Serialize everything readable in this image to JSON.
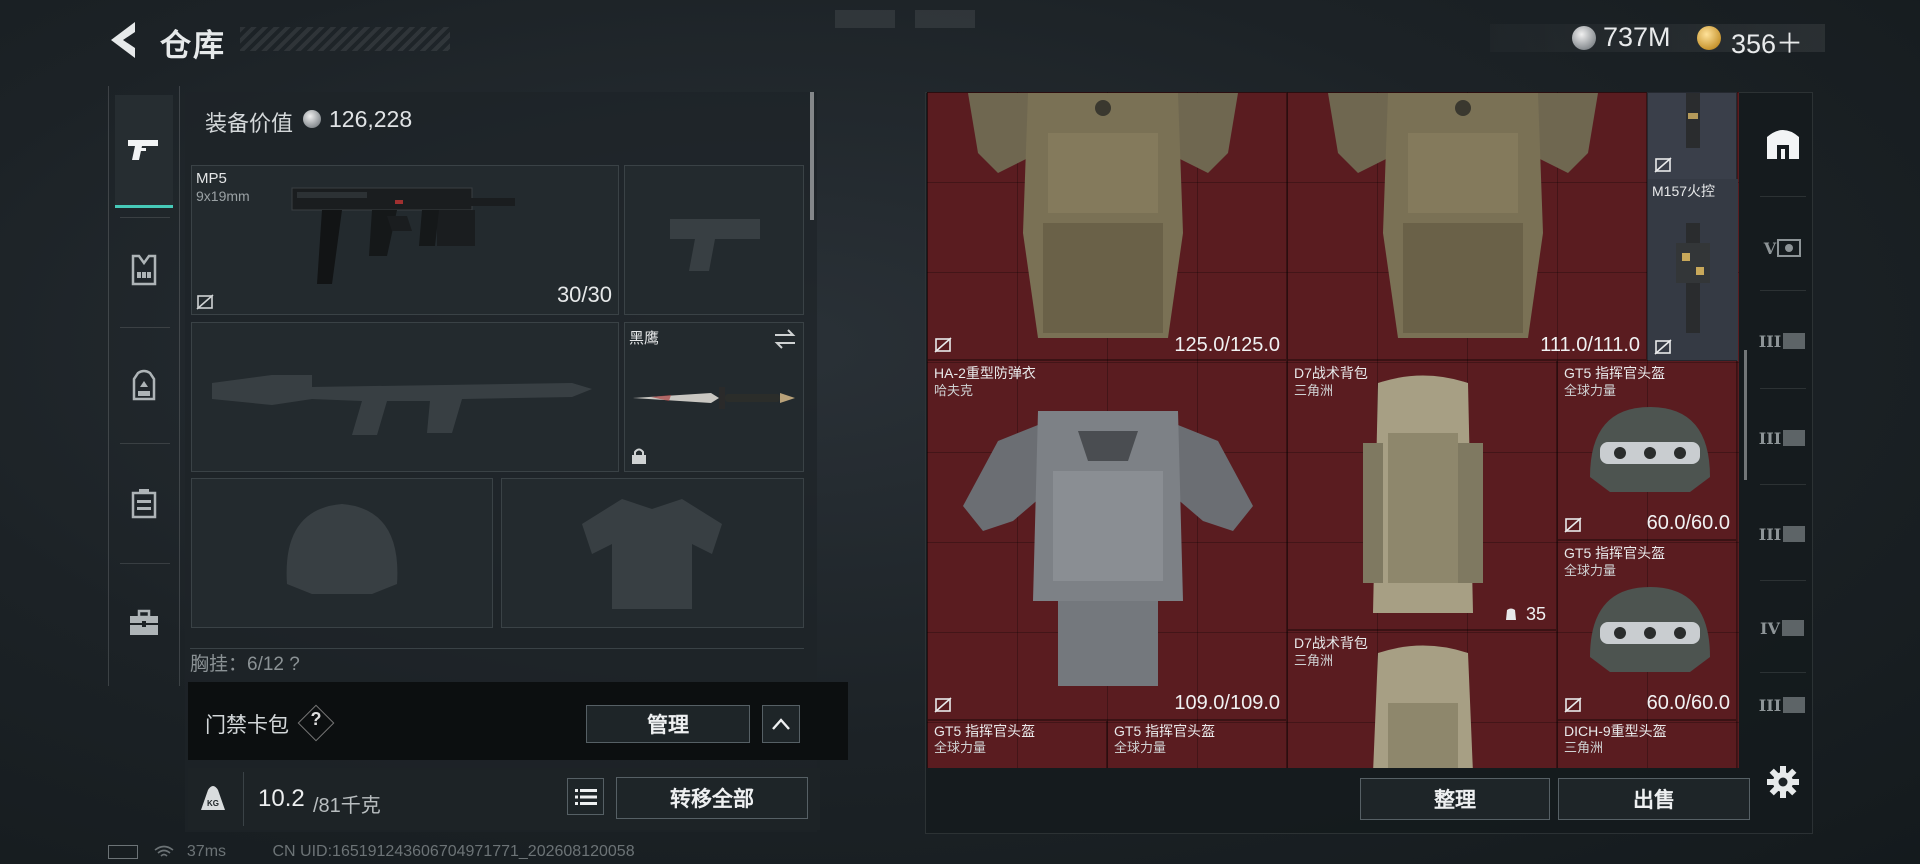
{
  "header": {
    "title": "仓库",
    "currencies": [
      {
        "name": "silver-coin",
        "amount": "737M"
      },
      {
        "name": "gold-coin",
        "amount": "356＋"
      }
    ]
  },
  "left_rail": {
    "items": [
      {
        "icon": "pistol-icon",
        "active": true
      },
      {
        "icon": "vest-icon",
        "active": false
      },
      {
        "icon": "backpack-icon",
        "active": false
      },
      {
        "icon": "container-icon",
        "active": false
      },
      {
        "icon": "case-icon",
        "active": false
      }
    ]
  },
  "loadout": {
    "value_label": "装备价值",
    "value": "126,228",
    "primary": {
      "name": "MP5",
      "caliber": "9x19mm",
      "ammo": "30/30"
    },
    "melee": {
      "name": "黑鹰"
    },
    "chest_row": "胸挂：6/12  ?",
    "card_pack_label": "门禁卡包",
    "card_help": "?",
    "manage_label": "管理",
    "weight_value": "10.2",
    "weight_max": "/81千克",
    "weight_icon_text": "KG",
    "transfer_all_label": "转移全部"
  },
  "stash": {
    "items": [
      {
        "name": "",
        "sub": "",
        "durability": "125.0/125.0",
        "kind": "vest-tan"
      },
      {
        "name": "",
        "sub": "",
        "durability": "111.0/111.0",
        "kind": "vest-tan"
      },
      {
        "name": "M157火控",
        "sub": "",
        "durability": "",
        "kind": "scope"
      },
      {
        "name": "HA-2重型防弹衣",
        "sub": "哈夫克",
        "durability": "109.0/109.0",
        "kind": "vest-grey"
      },
      {
        "name": "D7战术背包",
        "sub": "三角洲",
        "durability": "",
        "count": "35",
        "kind": "backpack"
      },
      {
        "name": "GT5 指挥官头盔",
        "sub": "全球力量",
        "durability": "60.0/60.0",
        "kind": "helmet"
      },
      {
        "name": "GT5 指挥官头盔",
        "sub": "全球力量",
        "durability": "60.0/60.0",
        "kind": "helmet"
      },
      {
        "name": "D7战术背包",
        "sub": "三角洲",
        "durability": "",
        "kind": "backpack"
      },
      {
        "name": "GT5 指挥官头盔",
        "sub": "全球力量",
        "durability": "",
        "kind": "helmet"
      },
      {
        "name": "GT5 指挥官头盔",
        "sub": "全球力量",
        "durability": "",
        "kind": "helmet"
      },
      {
        "name": "DICH-9重型头盔",
        "sub": "三角洲",
        "durability": "",
        "kind": "helmet"
      }
    ],
    "sort_label": "整理",
    "sell_label": "出售"
  },
  "right_rail": {
    "tabs": [
      "",
      "V",
      "III",
      "III",
      "III",
      "IV",
      "III"
    ]
  },
  "status_bar": {
    "ping": "37ms",
    "uid": "CN UID:16519124360670497177​1_202608120058"
  },
  "colors": {
    "accent": "#46c9b8",
    "grid_bg": "#5a1c20",
    "panel_bg": "#232a2e"
  }
}
